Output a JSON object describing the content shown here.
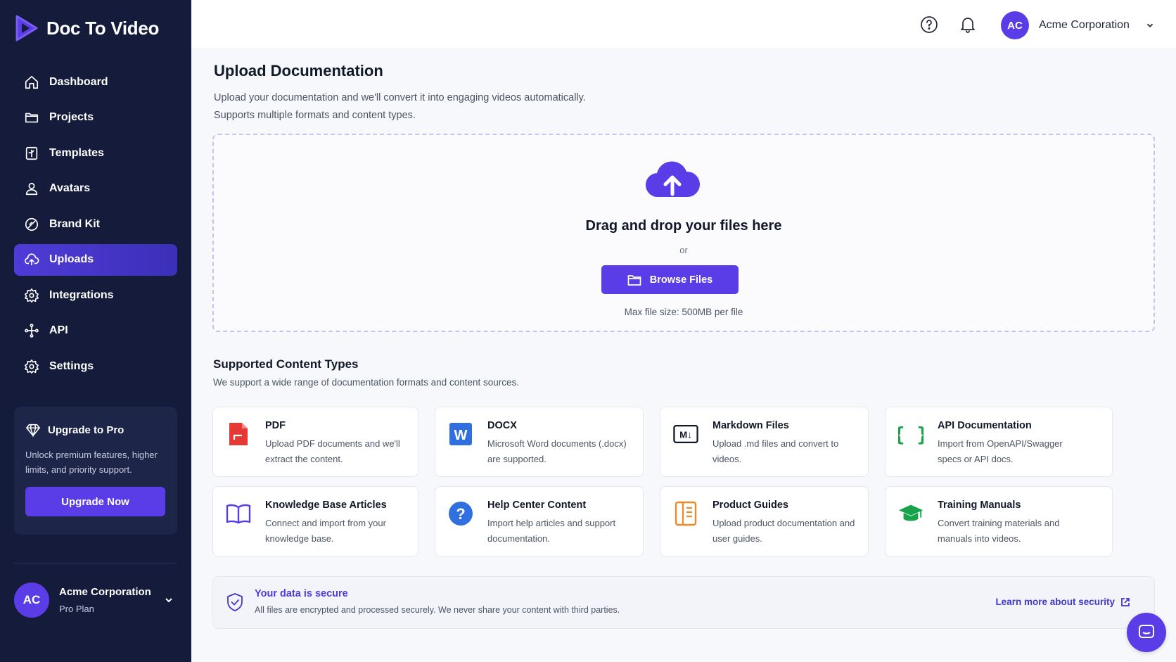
{
  "app": {
    "name": "Doc To Video"
  },
  "sidebar": {
    "items": [
      {
        "label": "Dashboard",
        "icon": "home-icon"
      },
      {
        "label": "Projects",
        "icon": "folder-icon"
      },
      {
        "label": "Templates",
        "icon": "template-icon"
      },
      {
        "label": "Avatars",
        "icon": "users-icon"
      },
      {
        "label": "Brand Kit",
        "icon": "palette-icon"
      },
      {
        "label": "Uploads",
        "icon": "cloud-upload-icon",
        "active": true
      },
      {
        "label": "Integrations",
        "icon": "gear-icon"
      },
      {
        "label": "API",
        "icon": "api-icon"
      },
      {
        "label": "Settings",
        "icon": "settings-icon"
      }
    ],
    "upgrade": {
      "title": "Upgrade to Pro",
      "text": "Unlock premium features, higher limits, and priority support.",
      "button": "Upgrade Now"
    },
    "account": {
      "initials": "AC",
      "name": "Acme Corporation",
      "plan": "Pro Plan"
    }
  },
  "topbar": {
    "initials": "AC",
    "account_name": "Acme Corporation"
  },
  "page": {
    "title": "Upload Documentation",
    "subtitle_line1": "Upload your documentation and we'll convert it into engaging videos automatically.",
    "subtitle_line2": "Supports multiple formats and content types."
  },
  "dropzone": {
    "title": "Drag and drop your files here",
    "or": "or",
    "browse": "Browse Files",
    "max_size": "Max file size: 500MB per file"
  },
  "content_types": {
    "title": "Supported Content Types",
    "subtitle": "We support a wide range of documentation formats and content sources.",
    "cards": [
      {
        "title": "PDF",
        "desc": "Upload PDF documents and we'll extract the content.",
        "icon": "pdf-icon",
        "color": "#e53935"
      },
      {
        "title": "DOCX",
        "desc": "Microsoft Word documents (.docx) are supported.",
        "icon": "word-icon",
        "color": "#2f6fe0",
        "badge": "W"
      },
      {
        "title": "Markdown Files",
        "desc": "Upload .md files and convert to videos.",
        "icon": "markdown-icon",
        "color": "#111827",
        "badge": "M↓"
      },
      {
        "title": "API Documentation",
        "desc": "Import from OpenAPI/Swagger specs or API docs.",
        "icon": "braces-icon",
        "color": "#16a34a",
        "badge": "{ }"
      },
      {
        "title": "Knowledge Base Articles",
        "desc": "Connect and import from your knowledge base.",
        "icon": "book-icon",
        "color": "#5b3de8"
      },
      {
        "title": "Help Center Content",
        "desc": "Import help articles and support documentation.",
        "icon": "help-circle-icon",
        "color": "#2f6fe0",
        "badge": "?"
      },
      {
        "title": "Product Guides",
        "desc": "Upload product documentation and user guides.",
        "icon": "guide-icon",
        "color": "#f08a24"
      },
      {
        "title": "Training Manuals",
        "desc": "Convert training materials and manuals into videos.",
        "icon": "graduation-cap-icon",
        "color": "#16a34a"
      }
    ]
  },
  "security": {
    "title": "Your data is secure",
    "text": "All files are encrypted and processed securely. We never share your content with third parties.",
    "link": "Learn more about security"
  },
  "colors": {
    "accent": "#5b3de8",
    "sidebar_bg": "#141b3b"
  }
}
